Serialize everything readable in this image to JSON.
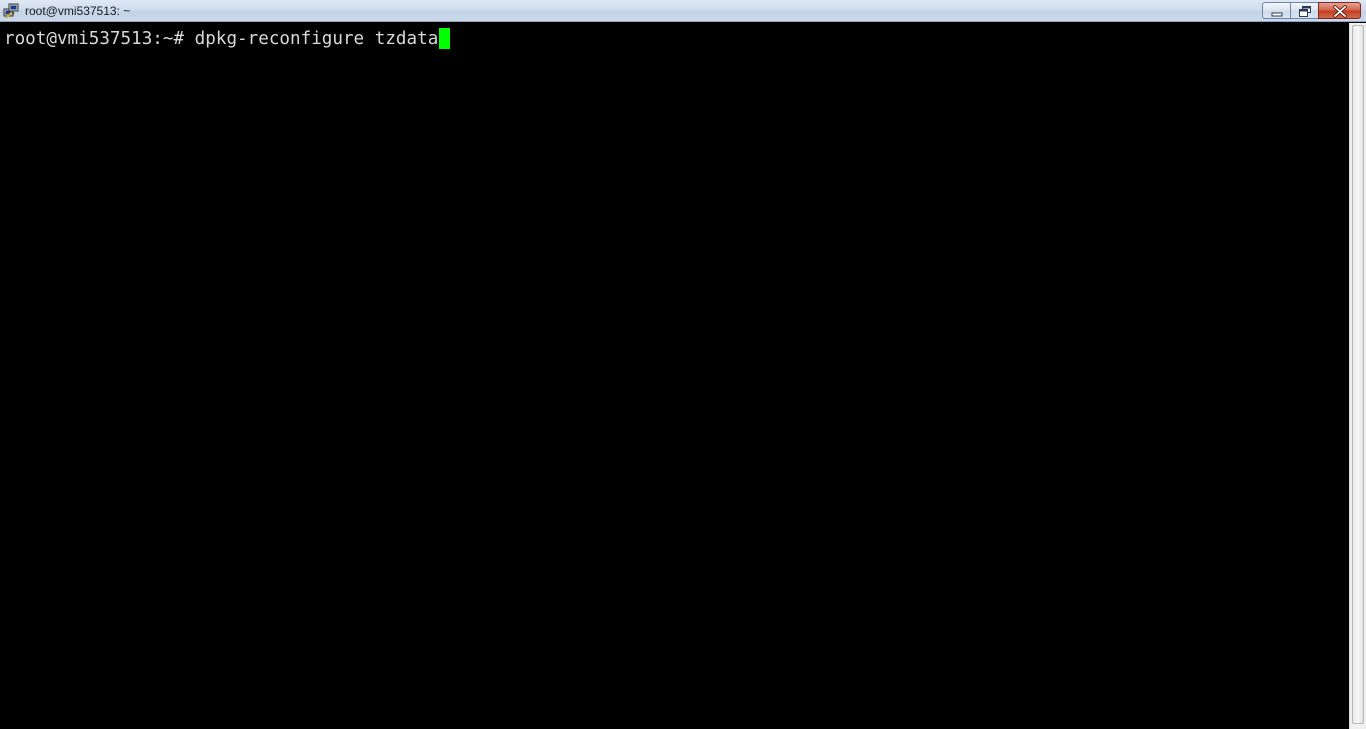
{
  "window": {
    "title": "root@vmi537513: ~",
    "app_icon": "putty-icon"
  },
  "caption_buttons": {
    "minimize_icon": "minimize-icon",
    "restore_icon": "restore-icon",
    "close_icon": "close-icon"
  },
  "terminal": {
    "prompt": "root@vmi537513:~# ",
    "command": "dpkg-reconfigure tzdata",
    "cursor_color": "#00ff00",
    "background": "#000000",
    "text_color": "#d8d8d8"
  },
  "scrollbar": {
    "position_fraction": 1.0
  }
}
